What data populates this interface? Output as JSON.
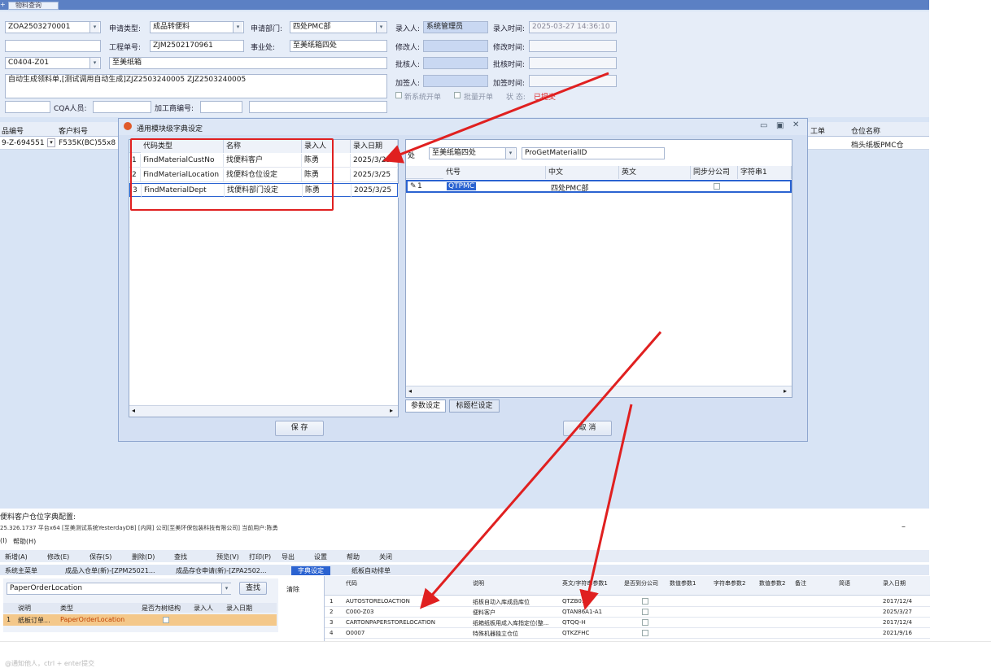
{
  "top_tab": "物料查询",
  "form": {
    "row1": {
      "code": "ZOA2503270001",
      "apply_type_label": "申请类型:",
      "apply_type": "成品转便料",
      "apply_dept_label": "申请部门:",
      "apply_dept": "四处PMC部",
      "entry_person_label": "录入人:",
      "entry_person": "系统管理员",
      "entry_time_label": "录入时间:",
      "entry_time": "2025-03-27 14:36:10"
    },
    "row2": {
      "work_no_label": "工程单号:",
      "work_no": "ZJM2502170961",
      "division_label": "事业处:",
      "division": "至美纸箱四处",
      "modifier_label": "修改人:",
      "modify_time_label": "修改时间:"
    },
    "row3": {
      "code": "C0404-Z01",
      "material": "至美纸箱",
      "approver_label": "批核人:",
      "approve_time_label": "批核时间:"
    },
    "row4": {
      "remark": "自动生成领料单,[测试调用自动生成]ZJZ2503240005 ZJZ2503240005",
      "closer_label": "加签人:",
      "close_time_label": "加签时间:"
    },
    "row5": {
      "new_sys": "新系统开单",
      "batch": "批量开单",
      "status_label": "状 态:",
      "status": "已提交"
    },
    "row6": {
      "cqa_label": "CQA人员:",
      "process_label": "加工商编号:"
    }
  },
  "grid": {
    "headers": [
      "品编号",
      "客户料号"
    ],
    "row": [
      "9-Z-694551",
      "F535K(BC)55x8"
    ],
    "right_headers": [
      "工单",
      "仓位名称"
    ],
    "right_row": [
      "",
      "档头纸板PMC仓"
    ]
  },
  "dialog": {
    "title": "通用模块级字典设定",
    "left_table": {
      "headers": [
        "代码类型",
        "名称",
        "录入人",
        "录入日期"
      ],
      "rows": [
        {
          "no": "1",
          "type": "FindMaterialCustNo",
          "name": "找便料客户",
          "person": "陈勇",
          "date": "2025/3/25"
        },
        {
          "no": "2",
          "type": "FindMaterialLocation",
          "name": "找便料仓位设定",
          "person": "陈勇",
          "date": "2025/3/25"
        },
        {
          "no": "3",
          "type": "FindMaterialDept",
          "name": "找便料部门设定",
          "person": "陈勇",
          "date": "2025/3/25"
        }
      ]
    },
    "division_label": "处",
    "division": "至美纸箱四处",
    "proc_name": "ProGetMaterialID",
    "right_table": {
      "headers": [
        "代号",
        "中文",
        "英文",
        "同步分公司",
        "字符串1"
      ],
      "rows": [
        {
          "no": "1",
          "code": "QTPMC",
          "cn": "四处PMC部",
          "en": ""
        }
      ]
    },
    "tabs": [
      "参数设定",
      "标题栏设定"
    ],
    "save_label": "保 存",
    "cancel_label": "取 消"
  },
  "lower": {
    "heading": "便料客户仓位字典配置:",
    "info": "25.326.1737 平台x64 [至美测试系统YesterdayDB] [内网] 公司[至美环保包装科技有限公司] 当前用户:陈勇",
    "menu": [
      "(I)",
      "帮助(H)"
    ],
    "toolbar": [
      "新增(A)",
      "修改(E)",
      "保存(S)",
      "删除(D)",
      "查找",
      "预览(V)",
      "打印(P)",
      "导出",
      "设置",
      "帮助",
      "关闭"
    ],
    "tabs": [
      "系统主菜单",
      "成品入仓单(新)-[ZPM25021...",
      "成品存仓申请(新)-[ZPA2502...",
      "字典设定",
      "纸板自动排单"
    ],
    "search_value": "PaperOrderLocation",
    "find_label": "查找",
    "clear_label": "清除",
    "left_headers": [
      "说明",
      "类型",
      "是否为树结构",
      "录入人",
      "录入日期"
    ],
    "left_row": {
      "no": "1",
      "desc": "纸板订单...",
      "type": "PaperOrderLocation"
    },
    "right_headers": [
      "代码",
      "说明",
      "英文/字符串参数1",
      "是否到分公司",
      "数值参数1",
      "字符串参数2",
      "数值参数2",
      "备注",
      "简语",
      "录入日期"
    ],
    "right_rows": [
      {
        "no": "1",
        "code": "AUTOSTORELOACTION",
        "desc": "纸板自动入库成品库位",
        "en": "QTZB01",
        "date": "2017/12/4"
      },
      {
        "no": "2",
        "code": "C000-Z03",
        "desc": "便料客户",
        "en": "QTAN86A1-A1",
        "date": "2025/3/27"
      },
      {
        "no": "3",
        "code": "CARTONPAPERSTORELOCATION",
        "desc": "纸箱纸板用成入库指定位(整...",
        "en": "QTQQ-H",
        "date": "2017/12/4"
      },
      {
        "no": "4",
        "code": "O0007",
        "desc": "特殊机器独立仓位",
        "en": "QTKZFHC",
        "date": "2021/9/16"
      }
    ]
  },
  "footer": "@通知他人，ctrl + enter提交",
  "colors": {
    "highlight_red": "#e02020",
    "selection_blue": "#2b63d1"
  }
}
